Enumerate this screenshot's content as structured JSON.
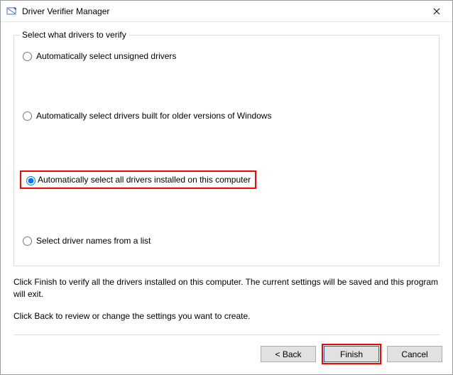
{
  "window": {
    "title": "Driver Verifier Manager"
  },
  "group": {
    "legend": "Select what drivers to verify",
    "options": [
      {
        "label": "Automatically select unsigned drivers"
      },
      {
        "label": "Automatically select drivers built for older versions of Windows"
      },
      {
        "label": "Automatically select all drivers installed on this computer"
      },
      {
        "label": "Select driver names from a list"
      }
    ],
    "selected_index": 2
  },
  "instructions": {
    "line1": "Click Finish to verify all the drivers installed on this computer. The current settings will be saved and this program will exit.",
    "line2": "Click Back to review or change the settings you want to create."
  },
  "buttons": {
    "back": "< Back",
    "finish": "Finish",
    "cancel": "Cancel"
  }
}
